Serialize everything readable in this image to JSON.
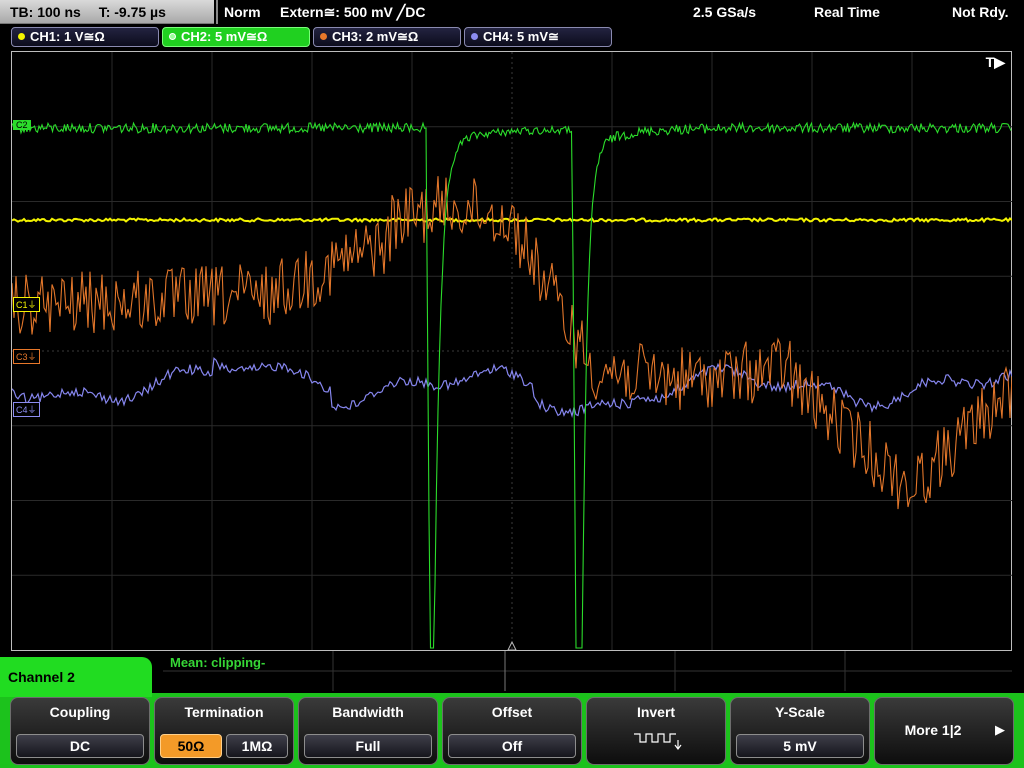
{
  "status_bar": {
    "timebase": "TB: 100 ns",
    "trigger_time": "T: -9.75 µs",
    "trigger_mode": "Norm",
    "trigger_source": "Extern≅: 500 mV ╱DC",
    "sample_rate": "2.5 GSa/s",
    "acq_mode": "Real Time",
    "state": "Not Rdy."
  },
  "channels": [
    {
      "label": "CH1: 1 V≅Ω",
      "color": "#f5f500"
    },
    {
      "label": "CH2: 5 mV≅Ω",
      "color": "#2bdc2b"
    },
    {
      "label": "CH3: 2 mV≅Ω",
      "color": "#e8782a"
    },
    {
      "label": "CH4: 5 mV≅",
      "color": "#8c8cf0"
    }
  ],
  "markers": {
    "trigger_position": "T▶",
    "ch2": "C2",
    "ch1": "C1⏚",
    "ch3": "C3⏚",
    "ch4": "C4⏚"
  },
  "measurement": {
    "text": "Mean: clipping-"
  },
  "menu": {
    "title": "Channel 2",
    "softkeys": [
      {
        "title": "Coupling",
        "value": "DC"
      },
      {
        "title": "Termination",
        "options": [
          "50Ω",
          "1MΩ"
        ],
        "selected": "50Ω"
      },
      {
        "title": "Bandwidth",
        "value": "Full"
      },
      {
        "title": "Offset",
        "value": "Off"
      },
      {
        "title": "Invert",
        "value": ""
      },
      {
        "title": "Y-Scale",
        "value": "5 mV"
      },
      {
        "title": "More 1|2",
        "value": ""
      }
    ]
  }
}
